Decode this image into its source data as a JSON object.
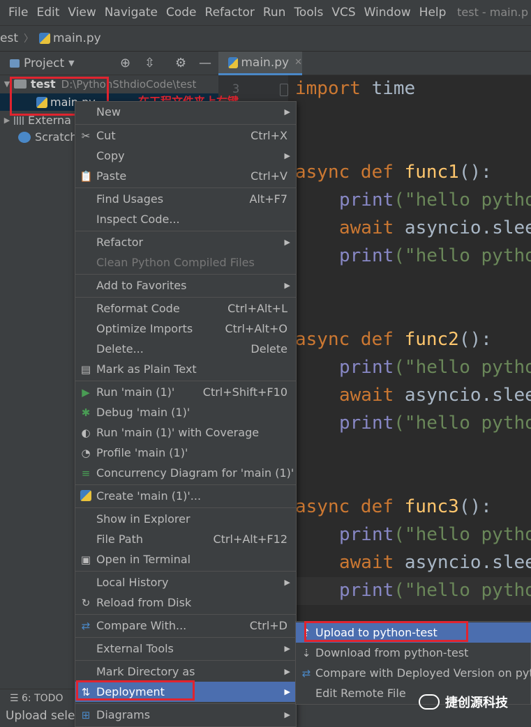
{
  "menubar": {
    "items": [
      "File",
      "Edit",
      "View",
      "Navigate",
      "Code",
      "Refactor",
      "Run",
      "Tools",
      "VCS",
      "Window",
      "Help"
    ],
    "window_title": "test - main.p"
  },
  "breadcrumb": {
    "project": "est",
    "file": "main.py"
  },
  "project_panel": {
    "title": "Project",
    "root_name": "test",
    "root_path": "D:\\PythonSthdioCode\\test",
    "file": "main.py",
    "external": "Externa",
    "scratch": "Scratch"
  },
  "editor": {
    "tab": "main.py",
    "line_number": "3",
    "code": {
      "l1": [
        "import",
        " time"
      ],
      "f1": [
        "async",
        " def ",
        "func1",
        "():"
      ],
      "f2": [
        "async",
        " def ",
        "func2",
        "():"
      ],
      "f3": [
        "async",
        " def ",
        "func3",
        "():"
      ],
      "print": "print",
      "hello": "(\"hello pytho",
      "await": "await",
      "asleep": " asyncio.slee"
    }
  },
  "annotation": "在工程文件夹上右键",
  "context_menu": [
    {
      "label": "New",
      "shortcut": "",
      "submenu": true
    },
    {
      "label": "Cut",
      "shortcut": "Ctrl+X",
      "icon": "cut-icon"
    },
    {
      "label": "Copy",
      "shortcut": "",
      "submenu": true
    },
    {
      "label": "Paste",
      "shortcut": "Ctrl+V",
      "icon": "paste-icon"
    },
    {
      "label": "Find Usages",
      "shortcut": "Alt+F7"
    },
    {
      "label": "Inspect Code...",
      "shortcut": ""
    },
    {
      "label": "Refactor",
      "shortcut": "",
      "submenu": true
    },
    {
      "label": "Clean Python Compiled Files",
      "shortcut": "",
      "disabled": true
    },
    {
      "label": "Add to Favorites",
      "shortcut": "",
      "submenu": true
    },
    {
      "label": "Reformat Code",
      "shortcut": "Ctrl+Alt+L"
    },
    {
      "label": "Optimize Imports",
      "shortcut": "Ctrl+Alt+O"
    },
    {
      "label": "Delete...",
      "shortcut": "Delete"
    },
    {
      "label": "Mark as Plain Text",
      "shortcut": "",
      "icon": "plain-text-icon"
    },
    {
      "label": "Run 'main (1)'",
      "shortcut": "Ctrl+Shift+F10",
      "icon": "run-icon"
    },
    {
      "label": "Debug 'main (1)'",
      "shortcut": "",
      "icon": "debug-icon"
    },
    {
      "label": "Run 'main (1)' with Coverage",
      "shortcut": "",
      "icon": "coverage-icon"
    },
    {
      "label": "Profile 'main (1)'",
      "shortcut": "",
      "icon": "profile-icon"
    },
    {
      "label": "Concurrency Diagram for 'main (1)'",
      "shortcut": "",
      "icon": "concurrency-icon"
    },
    {
      "label": "Create 'main (1)'...",
      "shortcut": "",
      "icon": "python-icon"
    },
    {
      "label": "Show in Explorer",
      "shortcut": ""
    },
    {
      "label": "File Path",
      "shortcut": "Ctrl+Alt+F12"
    },
    {
      "label": "Open in Terminal",
      "shortcut": "",
      "icon": "terminal-icon"
    },
    {
      "label": "Local History",
      "shortcut": "",
      "submenu": true
    },
    {
      "label": "Reload from Disk",
      "shortcut": "",
      "icon": "reload-icon"
    },
    {
      "label": "Compare With...",
      "shortcut": "Ctrl+D",
      "icon": "compare-icon"
    },
    {
      "label": "External Tools",
      "shortcut": "",
      "submenu": true
    },
    {
      "label": "Mark Directory as",
      "shortcut": "",
      "submenu": true
    },
    {
      "label": "Deployment",
      "shortcut": "",
      "submenu": true,
      "icon": "deployment-icon"
    },
    {
      "label": "Diagrams",
      "shortcut": "",
      "submenu": true,
      "icon": "diagrams-icon"
    }
  ],
  "submenu": [
    {
      "label": "Upload to python-test",
      "icon": "upload-icon"
    },
    {
      "label": "Download from python-test",
      "icon": "download-icon"
    },
    {
      "label": "Compare with Deployed Version on pyth",
      "icon": "compare-deployed-icon"
    },
    {
      "label": "Edit Remote File",
      "icon": ""
    }
  ],
  "statusbar": {
    "todo": "6: TODO",
    "upload_status": "Upload select"
  },
  "watermark": "捷创源科技",
  "colors": {
    "selection": "#4b6eaf",
    "annotation_red": "#e0242f",
    "tab_underline": "#4a88c7"
  }
}
